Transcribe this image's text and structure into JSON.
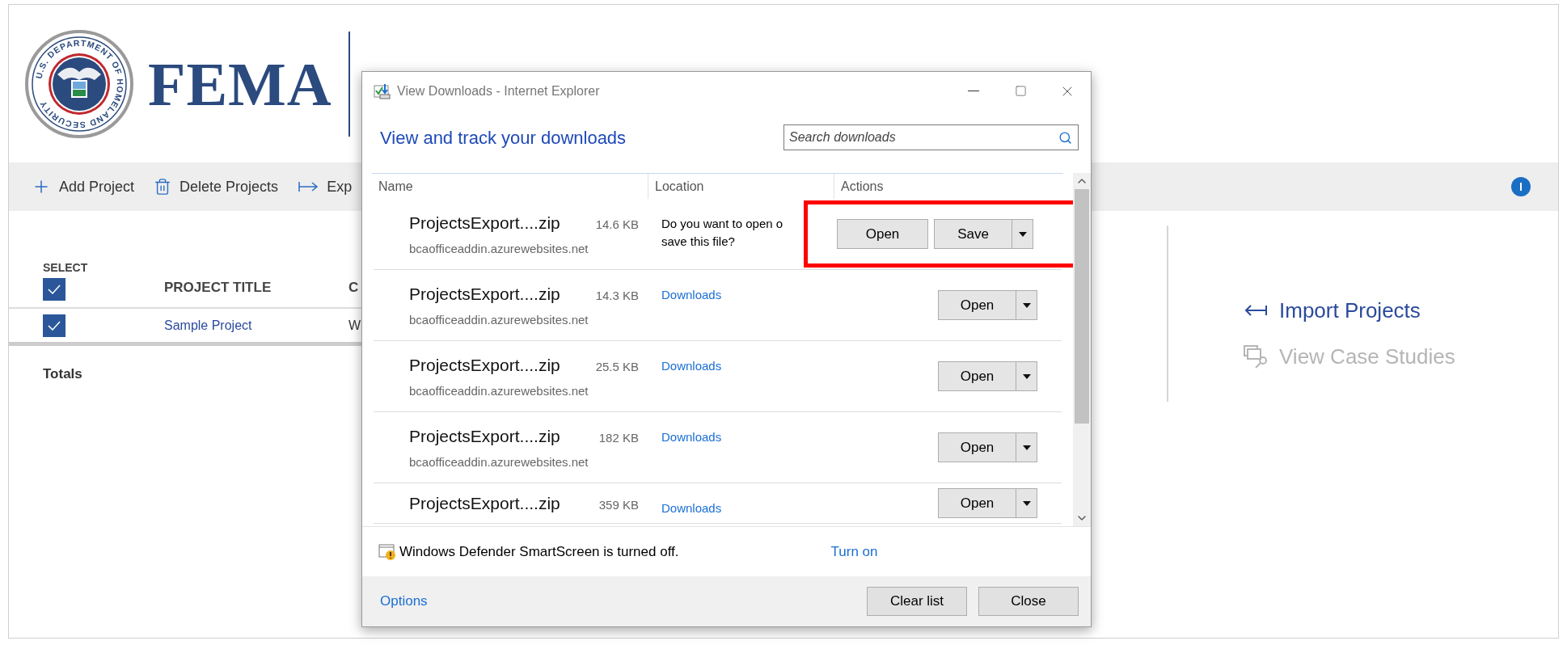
{
  "header": {
    "seal_text": "U.S. DEPARTMENT OF HOMELAND SECURITY",
    "logo_text": "FEMA"
  },
  "toolbar": [
    {
      "label": "Add Project"
    },
    {
      "label": "Delete Projects"
    },
    {
      "label": "Exp"
    }
  ],
  "table": {
    "select_header": "SELECT",
    "select_all_checked": true,
    "columns": [
      "PROJECT TITLE",
      "C"
    ],
    "rows": [
      {
        "checked": true,
        "title": "Sample Project",
        "column_3": "W"
      }
    ],
    "totals_label": "Totals"
  },
  "side_actions": [
    {
      "label": "Import Projects",
      "disabled": false
    },
    {
      "label": "View Case Studies",
      "disabled": true
    }
  ],
  "dialog": {
    "title": "View Downloads - Internet Explorer",
    "heading": "View and track your downloads",
    "search": {
      "placeholder": "Search downloads"
    },
    "columns": [
      "Name",
      "Location",
      "Actions"
    ],
    "downloads": [
      {
        "name": "ProjectsExport....zip",
        "size": "14.6 KB",
        "source": "bcaofficeaddin.azurewebsites.net",
        "kind": "prompt",
        "location_lines": [
          "Do you want to open o",
          "save this file?"
        ],
        "actions": [
          "Open",
          "Save"
        ],
        "highlighted": true
      },
      {
        "name": "ProjectsExport....zip",
        "size": "14.3 KB",
        "source": "bcaofficeaddin.azurewebsites.net",
        "kind": "link",
        "location_lines": [
          "Downloads"
        ],
        "actions": [
          "Open"
        ],
        "highlighted": false
      },
      {
        "name": "ProjectsExport....zip",
        "size": "25.5 KB",
        "source": "bcaofficeaddin.azurewebsites.net",
        "kind": "link",
        "location_lines": [
          "Downloads"
        ],
        "actions": [
          "Open"
        ],
        "highlighted": false
      },
      {
        "name": "ProjectsExport....zip",
        "size": "182 KB",
        "source": "bcaofficeaddin.azurewebsites.net",
        "kind": "link",
        "location_lines": [
          "Downloads"
        ],
        "actions": [
          "Open"
        ],
        "highlighted": false
      },
      {
        "name": "ProjectsExport....zip",
        "size": "359 KB",
        "kind": "link",
        "location_lines": [
          "Downloads"
        ],
        "actions": [
          "Open"
        ],
        "highlighted": false
      }
    ],
    "notice": {
      "text": "Windows Defender SmartScreen is turned off.",
      "link": "Turn on"
    },
    "footer": {
      "link": "Options",
      "buttons": [
        "Clear list",
        "Close"
      ]
    }
  }
}
